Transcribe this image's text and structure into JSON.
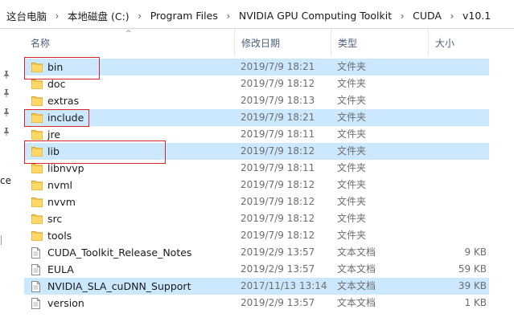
{
  "breadcrumb": {
    "items": [
      "这台电脑",
      "本地磁盘 (C:)",
      "Program Files",
      "NVIDIA GPU Computing Toolkit",
      "CUDA",
      "v10.1"
    ],
    "separator": "›"
  },
  "left_nav": {
    "partial_text": "ce"
  },
  "columns": {
    "name": "名称",
    "date": "修改日期",
    "type": "类型",
    "size": "大小"
  },
  "files": [
    {
      "name": "bin",
      "date": "2019/7/9 18:21",
      "type": "文件夹",
      "size": "",
      "icon": "folder-icon",
      "selected": true,
      "highlighted": true
    },
    {
      "name": "doc",
      "date": "2019/7/9 18:12",
      "type": "文件夹",
      "size": "",
      "icon": "folder-icon",
      "selected": false,
      "highlighted": false
    },
    {
      "name": "extras",
      "date": "2019/7/9 18:13",
      "type": "文件夹",
      "size": "",
      "icon": "folder-icon",
      "selected": false,
      "highlighted": false
    },
    {
      "name": "include",
      "date": "2019/7/9 18:21",
      "type": "文件夹",
      "size": "",
      "icon": "folder-icon",
      "selected": true,
      "highlighted": true
    },
    {
      "name": "jre",
      "date": "2019/7/9 18:11",
      "type": "文件夹",
      "size": "",
      "icon": "folder-icon",
      "selected": false,
      "highlighted": false
    },
    {
      "name": "lib",
      "date": "2019/7/9 18:12",
      "type": "文件夹",
      "size": "",
      "icon": "folder-icon",
      "selected": true,
      "highlighted": true
    },
    {
      "name": "libnvvp",
      "date": "2019/7/9 18:11",
      "type": "文件夹",
      "size": "",
      "icon": "folder-icon",
      "selected": false,
      "highlighted": false
    },
    {
      "name": "nvml",
      "date": "2019/7/9 18:12",
      "type": "文件夹",
      "size": "",
      "icon": "folder-icon",
      "selected": false,
      "highlighted": false
    },
    {
      "name": "nvvm",
      "date": "2019/7/9 18:12",
      "type": "文件夹",
      "size": "",
      "icon": "folder-icon",
      "selected": false,
      "highlighted": false
    },
    {
      "name": "src",
      "date": "2019/7/9 18:12",
      "type": "文件夹",
      "size": "",
      "icon": "folder-icon",
      "selected": false,
      "highlighted": false
    },
    {
      "name": "tools",
      "date": "2019/7/9 18:12",
      "type": "文件夹",
      "size": "",
      "icon": "folder-icon",
      "selected": false,
      "highlighted": false
    },
    {
      "name": "CUDA_Toolkit_Release_Notes",
      "date": "2019/2/9 13:57",
      "type": "文本文档",
      "size": "9 KB",
      "icon": "text-file-icon",
      "selected": false,
      "highlighted": false
    },
    {
      "name": "EULA",
      "date": "2019/2/9 13:57",
      "type": "文本文档",
      "size": "59 KB",
      "icon": "text-file-icon",
      "selected": false,
      "highlighted": false
    },
    {
      "name": "NVIDIA_SLA_cuDNN_Support",
      "date": "2017/11/13 13:14",
      "type": "文本文档",
      "size": "39 KB",
      "icon": "text-file-icon",
      "selected": true,
      "highlighted": false
    },
    {
      "name": "version",
      "date": "2019/2/9 13:57",
      "type": "文本文档",
      "size": "1 KB",
      "icon": "text-file-icon",
      "selected": false,
      "highlighted": false
    }
  ],
  "colors": {
    "selection": "#cce8ff",
    "highlight_box": "#d9262b",
    "folder": "#f5c84c",
    "header_text": "#4c607a",
    "secondary_text": "#6d6d6d"
  }
}
